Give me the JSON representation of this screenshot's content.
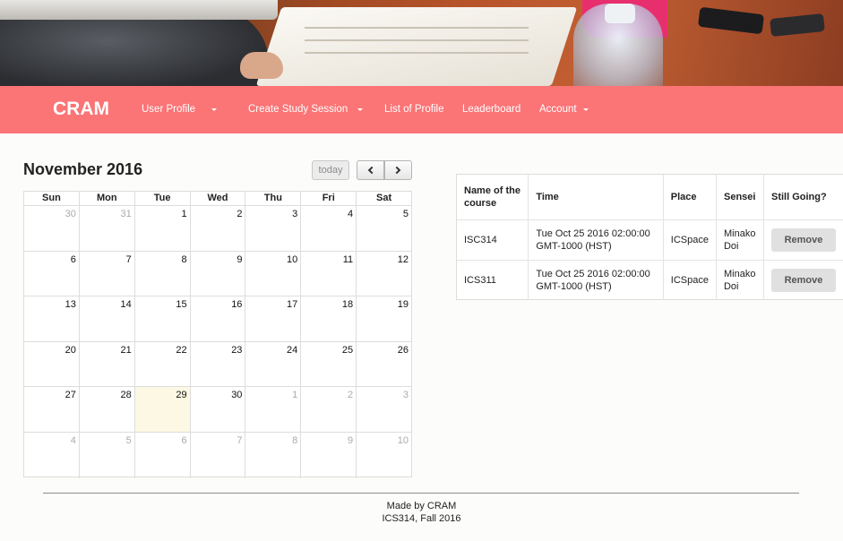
{
  "navbar": {
    "brand": "CRAM",
    "items": [
      {
        "label": "User Profile",
        "dropdown": true
      },
      {
        "label": "Create Study Session",
        "dropdown": true
      },
      {
        "label": "List of Profile",
        "dropdown": false
      },
      {
        "label": "Leaderboard",
        "dropdown": false
      },
      {
        "label": "Account",
        "dropdown": true
      }
    ]
  },
  "calendar": {
    "title": "November 2016",
    "today_label": "today",
    "weekdays": [
      "Sun",
      "Mon",
      "Tue",
      "Wed",
      "Thu",
      "Fri",
      "Sat"
    ],
    "weeks": [
      [
        "30",
        "31",
        "1",
        "2",
        "3",
        "4",
        "5"
      ],
      [
        "6",
        "7",
        "8",
        "9",
        "10",
        "11",
        "12"
      ],
      [
        "13",
        "14",
        "15",
        "16",
        "17",
        "18",
        "19"
      ],
      [
        "20",
        "21",
        "22",
        "23",
        "24",
        "25",
        "26"
      ],
      [
        "27",
        "28",
        "29",
        "30",
        "1",
        "2",
        "3"
      ],
      [
        "4",
        "5",
        "6",
        "7",
        "8",
        "9",
        "10"
      ]
    ],
    "highlighted_day": "29"
  },
  "sessions": {
    "headers": [
      "Name of the course",
      "Time",
      "Place",
      "Sensei",
      "Still Going?"
    ],
    "rows": [
      {
        "course": "ISC314",
        "time": "Tue Oct 25 2016 02:00:00 GMT-1000 (HST)",
        "place": "ICSpace",
        "sensei": "Minako Doi",
        "action": "Remove"
      },
      {
        "course": "ICS311",
        "time": "Tue Oct 25 2016 02:00:00 GMT-1000 (HST)",
        "place": "ICSpace",
        "sensei": "Minako Doi",
        "action": "Remove"
      }
    ]
  },
  "footer": {
    "line1": "Made by CRAM",
    "line2": "ICS314, Fall 2016"
  },
  "colors": {
    "navbar": "#fb7476",
    "today_cell": "#fcf8e3"
  }
}
